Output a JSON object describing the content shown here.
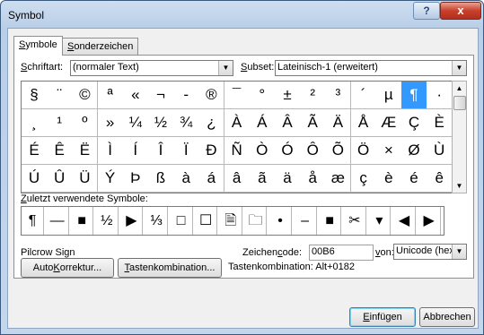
{
  "window": {
    "title": "Symbol",
    "help": "?",
    "close": "x"
  },
  "tabs": [
    {
      "pre": "",
      "key": "S",
      "post": "ymbole",
      "active": true
    },
    {
      "pre": "",
      "key": "S",
      "post": "onderzeichen",
      "active": false
    }
  ],
  "font": {
    "label_pre": "",
    "label_key": "S",
    "label_post": "chriftart:",
    "value": "(normaler Text)"
  },
  "subset": {
    "label_pre": "",
    "label_key": "S",
    "label_post": "ubset:",
    "value": "Lateinisch-1 (erweitert)"
  },
  "symbols": [
    [
      "§",
      "¨",
      "©",
      "ª",
      "«",
      "¬",
      "-",
      "®",
      "¯",
      "°",
      "±",
      "²",
      "³",
      "´",
      "µ",
      "¶",
      "·"
    ],
    [
      "¸",
      "¹",
      "º",
      "»",
      "¼",
      "½",
      "¾",
      "¿",
      "À",
      "Á",
      "Â",
      "Ã",
      "Ä",
      "Å",
      "Æ",
      "Ç",
      "È"
    ],
    [
      "É",
      "Ê",
      "Ë",
      "Ì",
      "Í",
      "Î",
      "Ï",
      "Ð",
      "Ñ",
      "Ò",
      "Ó",
      "Ô",
      "Õ",
      "Ö",
      "×",
      "Ø",
      "Ù"
    ],
    [
      "Ú",
      "Û",
      "Ü",
      "Ý",
      "Þ",
      "ß",
      "à",
      "á",
      "â",
      "ã",
      "ä",
      "å",
      "æ",
      "ç",
      "è",
      "é",
      "ê"
    ]
  ],
  "selected_symbol": "¶",
  "recent": {
    "label_pre": "",
    "label_key": "Z",
    "label_post": "uletzt verwendete Symbole:",
    "items": [
      "¶",
      "—",
      "■",
      "½",
      "▶",
      "⅓",
      "□",
      "☐",
      "🗎",
      "🗀",
      "•",
      "–",
      "■",
      "✂",
      "▾",
      "◀",
      "▶"
    ]
  },
  "char_name": "Pilcrow Sign",
  "charcode": {
    "label_pre": "Zeichen",
    "label_key": "c",
    "label_post": "ode:",
    "value": "00B6"
  },
  "from": {
    "label_pre": "",
    "label_key": "v",
    "label_post": "on:",
    "value": "Unicode (hex)"
  },
  "autocorrect": {
    "pre": "Auto",
    "key": "K",
    "post": "orrektur..."
  },
  "shortcut_btn": {
    "pre": "",
    "key": "T",
    "post": "astenkombination..."
  },
  "shortcut_info": "Tastenkombination: Alt+0182",
  "insert": {
    "pre": "",
    "key": "E",
    "post": "infügen"
  },
  "cancel": "Abbrechen"
}
